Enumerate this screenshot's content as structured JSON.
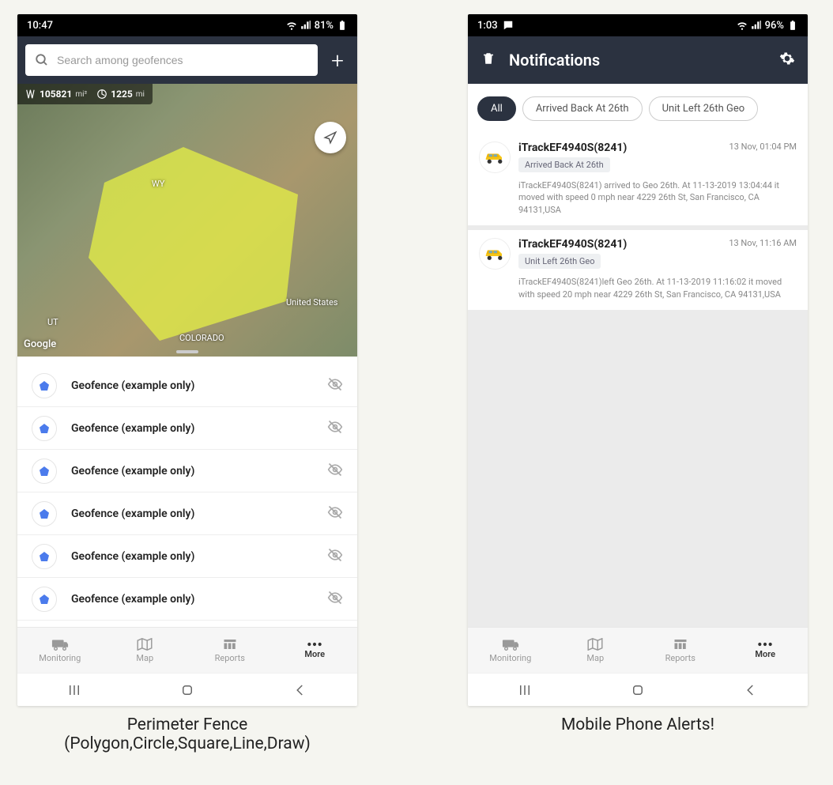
{
  "left": {
    "status": {
      "time": "10:47",
      "battery": "81%"
    },
    "search": {
      "placeholder": "Search among geofences"
    },
    "map": {
      "area_value": "105821",
      "area_unit": "mi²",
      "perimeter_value": "1225",
      "perimeter_unit": "mi",
      "labels": {
        "wy": "WY",
        "us": "United States",
        "ut": "UT",
        "co": "COLORADO"
      },
      "google": "Google"
    },
    "geofences": [
      {
        "name": "Geofence (example only)"
      },
      {
        "name": "Geofence (example only)"
      },
      {
        "name": "Geofence (example only)"
      },
      {
        "name": "Geofence (example only)"
      },
      {
        "name": "Geofence (example only)"
      },
      {
        "name": "Geofence (example only)"
      }
    ],
    "nav": {
      "monitoring": "Monitoring",
      "map": "Map",
      "reports": "Reports",
      "more": "More"
    },
    "caption_line1": "Perimeter Fence",
    "caption_line2": "(Polygon,Circle,Square,Line,Draw)"
  },
  "right": {
    "status": {
      "time": "1:03",
      "battery": "96%"
    },
    "header": {
      "title": "Notifications"
    },
    "chips": [
      {
        "label": "All",
        "active": true
      },
      {
        "label": "Arrived Back At 26th",
        "active": false
      },
      {
        "label": "Unit Left 26th Geo",
        "active": false
      }
    ],
    "notifications": [
      {
        "title": "iTrackEF4940S(8241)",
        "badge": "Arrived Back At 26th",
        "time": "13 Nov, 01:04 PM",
        "body": "iTrackEF4940S(8241) arrived to Geo 26th.     At 11-13-2019 13:04:44 it moved with speed 0 mph near 4229 26th St, San Francisco, CA 94131,USA"
      },
      {
        "title": "iTrackEF4940S(8241)",
        "badge": "Unit Left 26th Geo",
        "time": "13 Nov, 11:16 AM",
        "body": "iTrackEF4940S(8241)left Geo 26th.     At 11-13-2019 11:16:02 it moved with speed 20 mph near 4229 26th St, San Francisco, CA 94131,USA"
      }
    ],
    "nav": {
      "monitoring": "Monitoring",
      "map": "Map",
      "reports": "Reports",
      "more": "More"
    },
    "caption": "Mobile Phone Alerts!"
  }
}
